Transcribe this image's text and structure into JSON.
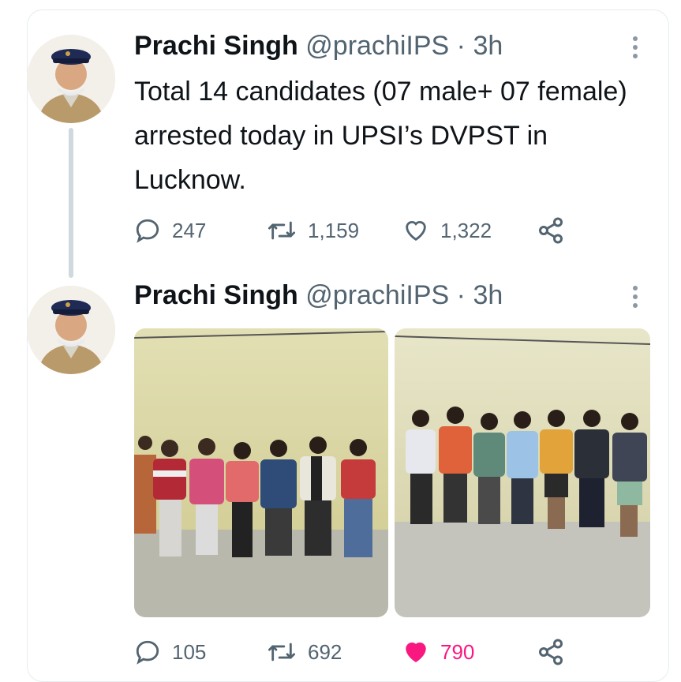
{
  "tweets": [
    {
      "author": {
        "name": "Prachi Singh",
        "handle": "@prachiIPS",
        "time": "3h"
      },
      "separator": "·",
      "text": "Total 14 candidates (07 male+ 07 female) arrested today in UPSI’s DVPST in Lucknow.",
      "stats": {
        "replies": "247",
        "retweets": "1,159",
        "likes": "1,322"
      },
      "liked": false
    },
    {
      "author": {
        "name": "Prachi Singh",
        "handle": "@prachiIPS",
        "time": "3h"
      },
      "separator": "·",
      "text": "",
      "stats": {
        "replies": "105",
        "retweets": "692",
        "likes": "790"
      },
      "liked": true
    }
  ],
  "icons": {
    "reply": "reply-icon",
    "retweet": "retweet-icon",
    "like": "heart-icon",
    "share": "share-icon",
    "more": "more-icon"
  },
  "colors": {
    "liked": "#f91880",
    "secondary_text": "#536471",
    "thread_line": "#cfd9de"
  }
}
